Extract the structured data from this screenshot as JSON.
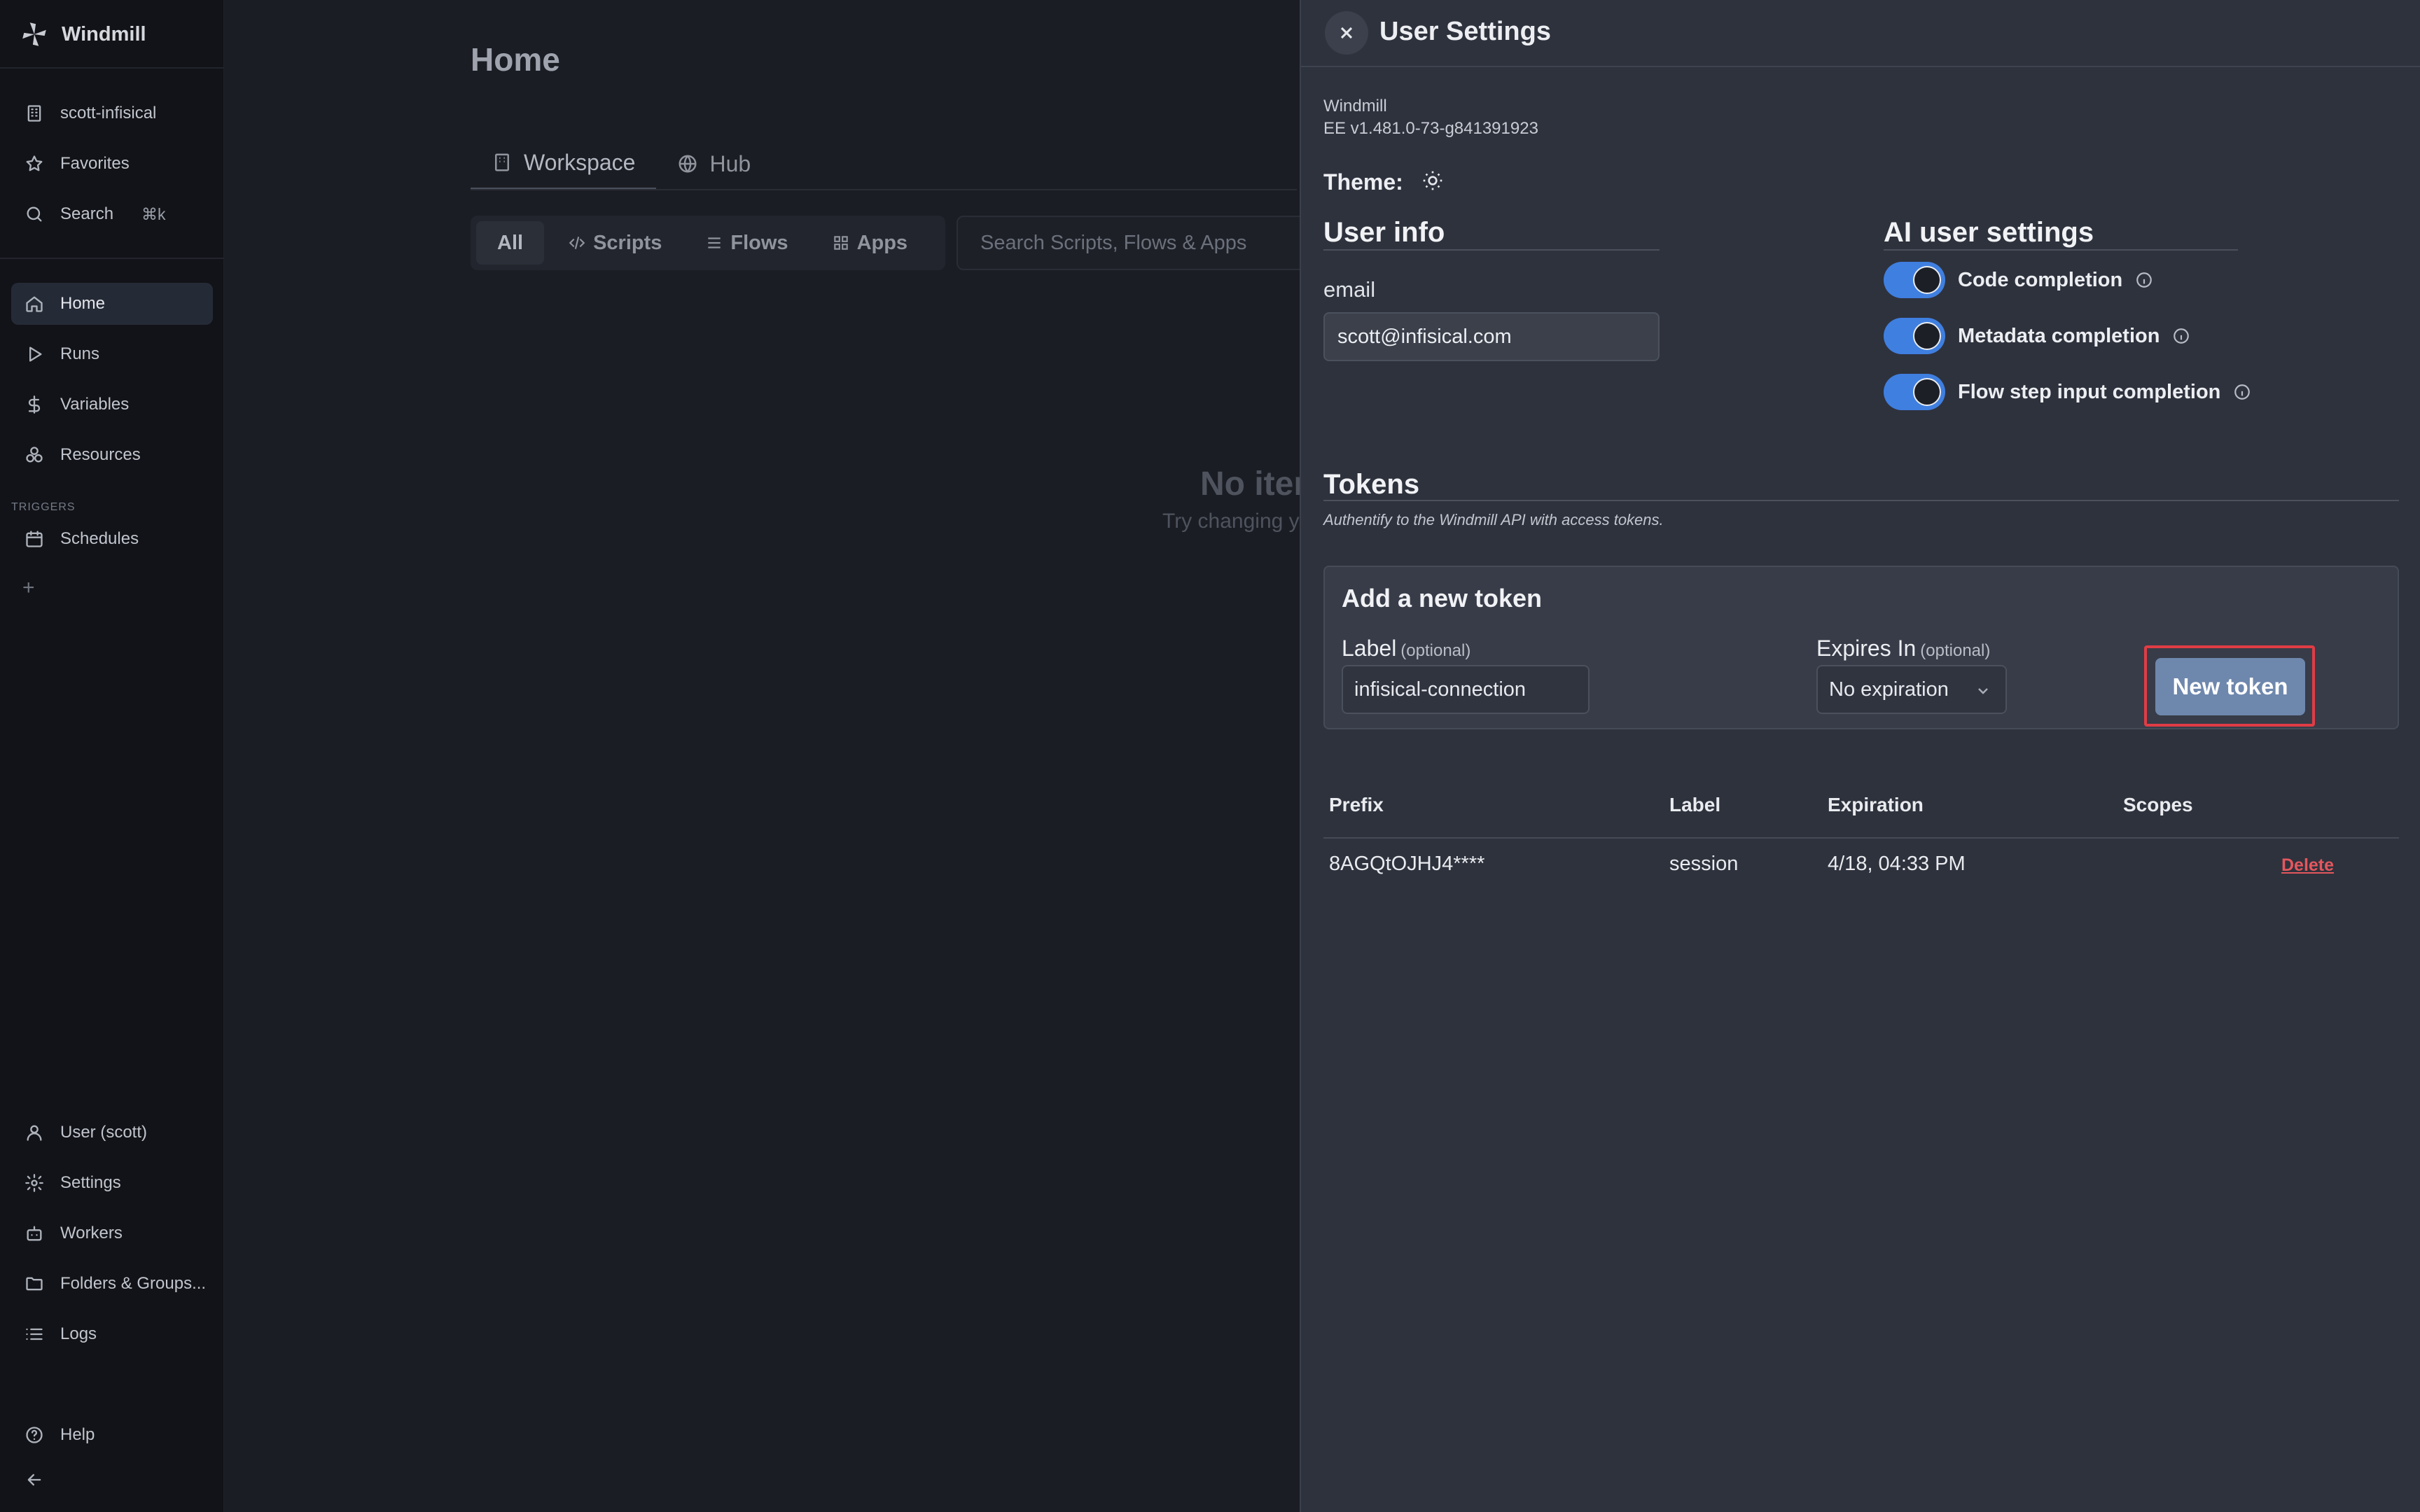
{
  "app": {
    "name": "Windmill"
  },
  "sidebar": {
    "workspace": "scott-infisical",
    "favorites": "Favorites",
    "search": {
      "label": "Search",
      "shortcut": "⌘k"
    },
    "nav": [
      {
        "label": "Home",
        "icon": "home-icon",
        "active": true
      },
      {
        "label": "Runs",
        "icon": "play-icon"
      },
      {
        "label": "Variables",
        "icon": "dollar-icon"
      },
      {
        "label": "Resources",
        "icon": "boxes-icon"
      }
    ],
    "triggers_label": "TRIGGERS",
    "triggers": [
      {
        "label": "Schedules",
        "icon": "calendar-icon"
      }
    ],
    "add_symbol": "+",
    "bottom": [
      {
        "label": "User (scott)",
        "icon": "user-icon"
      },
      {
        "label": "Settings",
        "icon": "gear-icon"
      },
      {
        "label": "Workers",
        "icon": "bot-icon"
      },
      {
        "label": "Folders & Groups...",
        "icon": "folder-icon"
      },
      {
        "label": "Logs",
        "icon": "list-icon"
      }
    ],
    "help": "Help",
    "collapse_icon": "arrow-left-icon"
  },
  "main": {
    "title": "Home",
    "tabs": [
      {
        "label": "Workspace"
      },
      {
        "label": "Hub"
      }
    ],
    "filters": [
      "All",
      "Scripts",
      "Flows",
      "Apps"
    ],
    "search_placeholder": "Search Scripts, Flows & Apps",
    "empty_title": "No iter",
    "empty_sub": "Try changing y"
  },
  "settings": {
    "title": "User Settings",
    "version_name": "Windmill",
    "version": "EE v1.481.0-73-g841391923",
    "theme_label": "Theme:",
    "theme_icon": "sun-icon",
    "user_info": {
      "title": "User info",
      "email_label": "email",
      "email": "scott@infisical.com"
    },
    "ai": {
      "title": "AI user settings",
      "items": [
        {
          "label": "Code completion",
          "enabled": true
        },
        {
          "label": "Metadata completion",
          "enabled": true
        },
        {
          "label": "Flow step input completion",
          "enabled": true
        }
      ]
    },
    "tokens": {
      "title": "Tokens",
      "subtitle": "Authentify to the Windmill API with access tokens.",
      "add": {
        "title": "Add a new token",
        "label_label": "Label",
        "label_optional": "(optional)",
        "label_value": "infisical-connection",
        "expires_label": "Expires In",
        "expires_optional": "(optional)",
        "expires_value": "No expiration",
        "button": "New token"
      },
      "columns": [
        "Prefix",
        "Label",
        "Expiration",
        "Scopes"
      ],
      "rows": [
        {
          "prefix": "8AGQtOJHJ4****",
          "label": "session",
          "expiration": "4/18, 04:33 PM",
          "scopes": "",
          "action": "Delete"
        }
      ]
    }
  },
  "colors": {
    "accent": "#3f7fe0",
    "button": "#6e87ad",
    "highlight": "#e03c45",
    "danger": "#e4575d"
  }
}
